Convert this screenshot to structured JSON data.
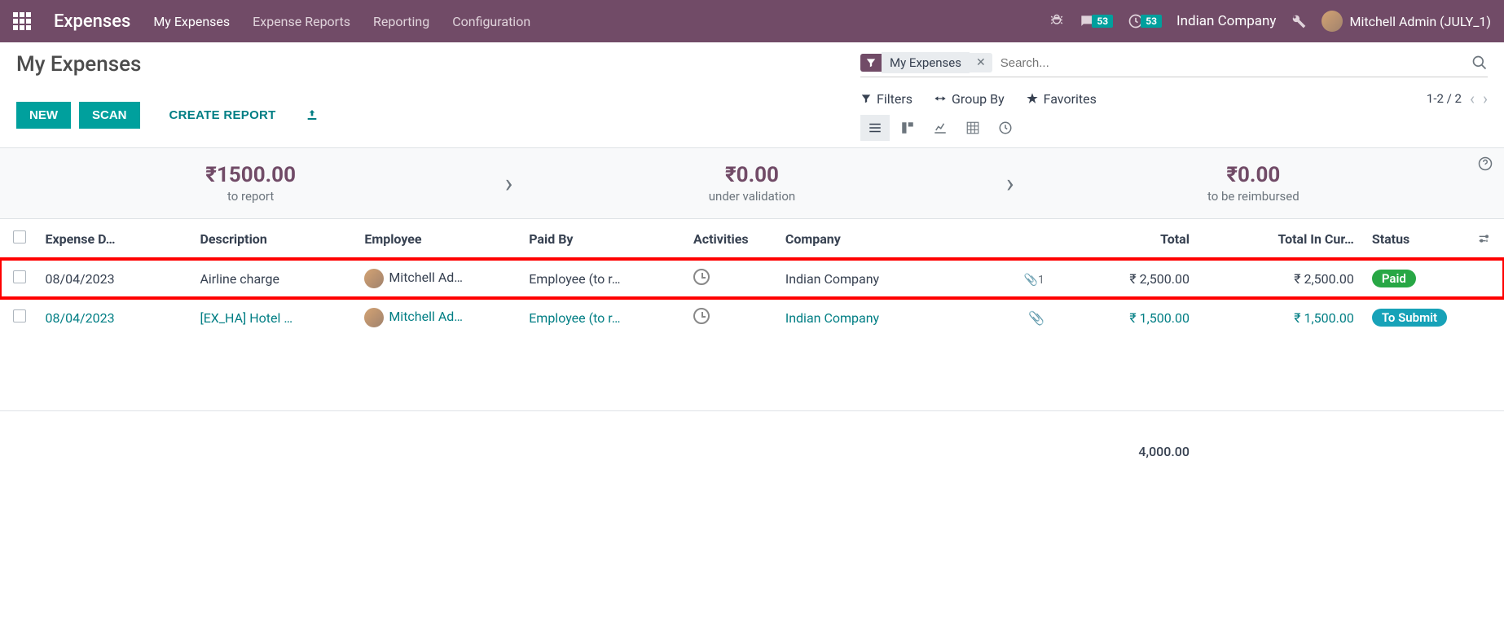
{
  "navbar": {
    "app_title": "Expenses",
    "menu": [
      {
        "label": "My Expenses"
      },
      {
        "label": "Expense Reports"
      },
      {
        "label": "Reporting"
      },
      {
        "label": "Configuration"
      }
    ],
    "messages_badge": "53",
    "activities_badge": "53",
    "company": "Indian Company",
    "user": "Mitchell Admin (JULY_1)"
  },
  "breadcrumb": {
    "title": "My Expenses"
  },
  "actions": {
    "new": "NEW",
    "scan": "SCAN",
    "create_report": "CREATE REPORT"
  },
  "search": {
    "facet_label": "My Expenses",
    "placeholder": "Search..."
  },
  "filter_bar": {
    "filters": "Filters",
    "group_by": "Group By",
    "favorites": "Favorites",
    "pager": "1-2 / 2"
  },
  "statusbar": {
    "to_report": {
      "amount": "₹1500.00",
      "label": "to report"
    },
    "under_validation": {
      "amount": "₹0.00",
      "label": "under validation"
    },
    "to_be_reimbursed": {
      "amount": "₹0.00",
      "label": "to be reimbursed"
    }
  },
  "columns": {
    "date": "Expense D…",
    "description": "Description",
    "employee": "Employee",
    "paid_by": "Paid By",
    "activities": "Activities",
    "company": "Company",
    "total": "Total",
    "total_currency": "Total In Cur…",
    "status": "Status"
  },
  "rows": [
    {
      "date": "08/04/2023",
      "description": "Airline charge",
      "employee": "Mitchell Ad…",
      "paid_by": "Employee (to r…",
      "company": "Indian Company",
      "attach_count": "1",
      "total": "₹ 2,500.00",
      "total_currency": "₹ 2,500.00",
      "status": "Paid",
      "highlighted": true
    },
    {
      "date": "08/04/2023",
      "description": "[EX_HA] Hotel …",
      "employee": "Mitchell Ad…",
      "paid_by": "Employee (to r…",
      "company": "Indian Company",
      "attach_count": "",
      "total": "₹ 1,500.00",
      "total_currency": "₹ 1,500.00",
      "status": "To Submit"
    }
  ],
  "footer": {
    "total": "4,000.00"
  }
}
